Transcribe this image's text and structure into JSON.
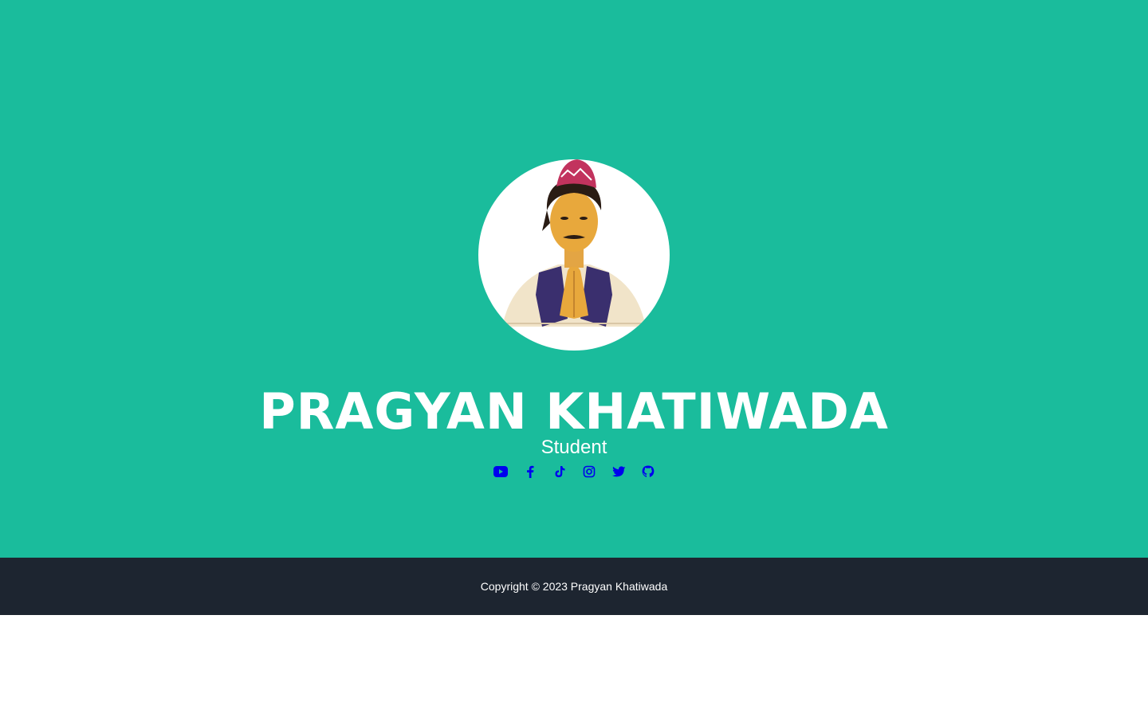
{
  "profile": {
    "name": "PRAGYAN KHATIWADA",
    "role": "Student",
    "avatar_icon": "profile-photo"
  },
  "socials": [
    {
      "icon": "youtube-icon"
    },
    {
      "icon": "facebook-icon"
    },
    {
      "icon": "tiktok-icon"
    },
    {
      "icon": "instagram-icon"
    },
    {
      "icon": "twitter-icon"
    },
    {
      "icon": "github-icon"
    }
  ],
  "footer": {
    "copyright": "Copyright © 2023 Pragyan Khatiwada"
  },
  "colors": {
    "masthead_bg": "#1abc9c",
    "footer_bg": "#1d2530",
    "link": "#0000ee",
    "text_light": "#ffffff"
  }
}
